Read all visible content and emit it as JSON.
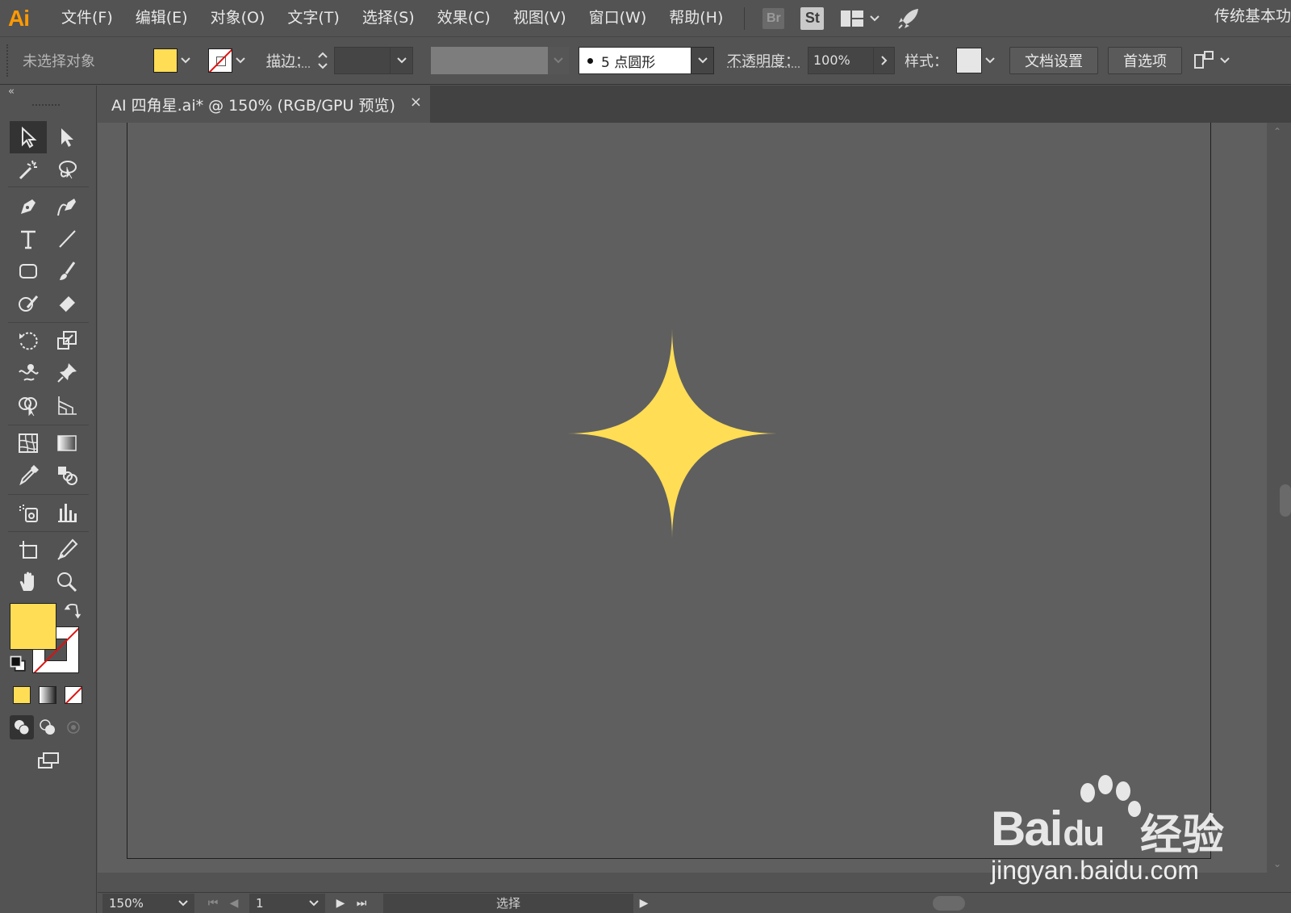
{
  "app": {
    "logo": "Ai",
    "workspace": "传统基本功"
  },
  "menu": [
    "文件(F)",
    "编辑(E)",
    "对象(O)",
    "文字(T)",
    "选择(S)",
    "效果(C)",
    "视图(V)",
    "窗口(W)",
    "帮助(H)"
  ],
  "menubar_icons": {
    "bridge": "Br",
    "stock": "St"
  },
  "controlbar": {
    "selection_status": "未选择对象",
    "stroke_label": "描边：",
    "brush_value": "5 点圆形",
    "opacity_label": "不透明度：",
    "opacity_value": "100%",
    "style_label": "样式：",
    "document_setup_button": "文档设置",
    "preferences_button": "首选项"
  },
  "document_tab": {
    "title": "AI 四角星.ai* @ 150% (RGB/GPU 预览)",
    "close": "×"
  },
  "colors": {
    "fill": "#ffdd55",
    "stroke": "none",
    "star": "#ffdd55",
    "accent": "#ff9a00"
  },
  "statusbar": {
    "zoom": "150%",
    "page": "1",
    "status": "选择"
  },
  "watermark": {
    "brand": "Bai",
    "brand_suffix": "du",
    "product": "经验",
    "url": "jingyan.baidu.com"
  }
}
